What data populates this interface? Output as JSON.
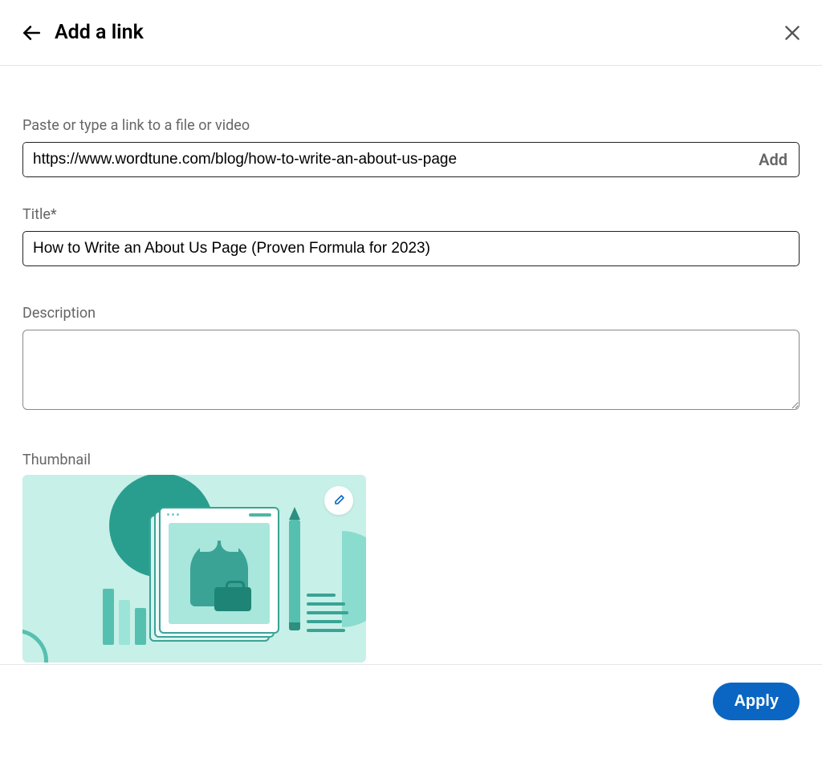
{
  "header": {
    "title": "Add a link"
  },
  "link_field": {
    "label": "Paste or type a link to a file or video",
    "value": "https://www.wordtune.com/blog/how-to-write-an-about-us-page",
    "add_label": "Add"
  },
  "title_field": {
    "label": "Title*",
    "value": "How to Write an About Us Page (Proven Formula for 2023)"
  },
  "description_field": {
    "label": "Description",
    "value": ""
  },
  "thumbnail": {
    "label": "Thumbnail"
  },
  "footer": {
    "apply_label": "Apply"
  }
}
